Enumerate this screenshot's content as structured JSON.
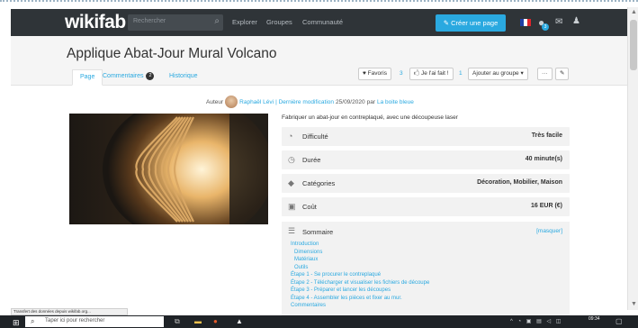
{
  "navbar": {
    "logo": "wikifab",
    "search_placeholder": "Rechercher",
    "links": [
      "Explorer",
      "Groupes",
      "Communauté"
    ],
    "create_button": "✎ Créer une page",
    "notif_count": "3"
  },
  "page": {
    "title": "Applique Abat-Jour Mural Volcano",
    "tabs": {
      "page": "Page",
      "comments": "Commentaires",
      "comments_count": "2",
      "history": "Historique"
    },
    "actions": {
      "favorites": "♥ Favoris",
      "favorites_count": "3",
      "made_it": "🖒 Je l'ai fait !",
      "made_it_count": "1",
      "add_group": "Ajouter au groupe ▾",
      "more": "···",
      "edit": "✎"
    }
  },
  "author": {
    "prefix": "Auteur",
    "name": "Raphaël Lévi",
    "last_mod_label": "| Dernière modification",
    "date": "25/09/2020",
    "by": "par",
    "modifier": "La boite bleue"
  },
  "description": "Fabriquer un abat-jour en contreplaqué, avec une découpeuse laser",
  "info": [
    {
      "icon": "gauge-icon",
      "glyph": "◔",
      "label": "Difficulté",
      "value": "Très facile"
    },
    {
      "icon": "clock-icon",
      "glyph": "◷",
      "label": "Durée",
      "value": "40 minute(s)"
    },
    {
      "icon": "tag-icon",
      "glyph": "◆",
      "label": "Catégories",
      "value": "Décoration, Mobilier, Maison"
    },
    {
      "icon": "money-icon",
      "glyph": "▣",
      "label": "Coût",
      "value": "16 EUR (€)"
    }
  ],
  "toc": {
    "title": "Sommaire",
    "hide": "[masquer]",
    "items": [
      {
        "text": "Introduction",
        "sub": false
      },
      {
        "text": "Dimensions",
        "sub": true
      },
      {
        "text": "Matériaux",
        "sub": true
      },
      {
        "text": "Outils",
        "sub": true
      },
      {
        "text": "Étape 1 - Se procurer le contreplaqué",
        "sub": false
      },
      {
        "text": "Étape 2 - Télécharger et visualiser les fichiers de découpe",
        "sub": false
      },
      {
        "text": "Étape 3 - Préparer et lancer les découpes",
        "sub": false
      },
      {
        "text": "Étape 4 - Assembler les pièces et fixer au mur.",
        "sub": false
      },
      {
        "text": "Commentaires",
        "sub": false
      }
    ]
  },
  "status_bar": "Transfert des données depuis wikifab.org...",
  "taskbar": {
    "search_placeholder": "Taper ici pour rechercher",
    "time": "09:34",
    "date": ""
  },
  "colors": {
    "accent": "#2aa9e0",
    "navbar": "#2f3438",
    "flag_blue": "#1f3fa6",
    "flag_white": "#ffffff",
    "flag_red": "#e2242b"
  }
}
